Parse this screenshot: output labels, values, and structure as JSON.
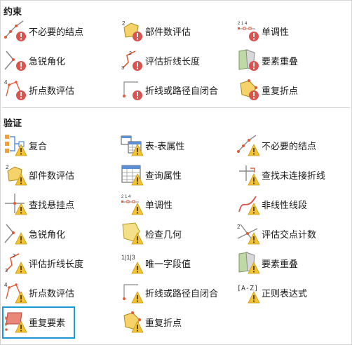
{
  "sections": [
    {
      "title": "约束",
      "items": [
        {
          "label": "不必要的结点",
          "icon": "unnecessary-vertex-icon"
        },
        {
          "label": "部件数评估",
          "icon": "part-count-icon"
        },
        {
          "label": "单调性",
          "icon": "monotonicity-icon"
        },
        {
          "label": "急锐角化",
          "icon": "sharp-angle-icon"
        },
        {
          "label": "评估折线长度",
          "icon": "polyline-length-icon"
        },
        {
          "label": "要素重叠",
          "icon": "feature-overlap-icon"
        },
        {
          "label": "折点数评估",
          "icon": "vertex-count-icon"
        },
        {
          "label": "折线或路径自闭合",
          "icon": "self-closing-icon"
        },
        {
          "label": "重复折点",
          "icon": "duplicate-vertex-icon"
        }
      ]
    },
    {
      "title": "验证",
      "items": [
        {
          "label": "复合",
          "icon": "composite-icon"
        },
        {
          "label": "表-表属性",
          "icon": "table-to-table-icon"
        },
        {
          "label": "不必要的结点",
          "icon": "unnecessary-vertex-icon"
        },
        {
          "label": "部件数评估",
          "icon": "part-count-icon"
        },
        {
          "label": "查询属性",
          "icon": "query-attribute-icon"
        },
        {
          "label": "查找未连接折线",
          "icon": "unconnected-line-icon"
        },
        {
          "label": "查找悬挂点",
          "icon": "dangle-icon"
        },
        {
          "label": "单调性",
          "icon": "monotonicity-icon"
        },
        {
          "label": "非线性线段",
          "icon": "nonlinear-segment-icon"
        },
        {
          "label": "急锐角化",
          "icon": "sharp-angle-icon"
        },
        {
          "label": "检查几何",
          "icon": "check-geometry-icon"
        },
        {
          "label": "评估交点计数",
          "icon": "intersection-count-icon"
        },
        {
          "label": "评估折线长度",
          "icon": "polyline-length-icon"
        },
        {
          "label": "唯一字段值",
          "icon": "unique-field-icon"
        },
        {
          "label": "要素重叠",
          "icon": "feature-overlap-icon"
        },
        {
          "label": "折点数评估",
          "icon": "vertex-count-icon"
        },
        {
          "label": "折线或路径自闭合",
          "icon": "self-closing-icon"
        },
        {
          "label": "正则表达式",
          "icon": "regex-icon"
        },
        {
          "label": "重复要素",
          "icon": "duplicate-feature-icon"
        },
        {
          "label": "重复折点",
          "icon": "duplicate-vertex-icon"
        }
      ]
    }
  ],
  "selected_label": "重复要素",
  "colors": {
    "accent": "#1a9bd7",
    "error": "#d9534f",
    "warning": "#f2c230",
    "divider": "#d4d4d4"
  }
}
